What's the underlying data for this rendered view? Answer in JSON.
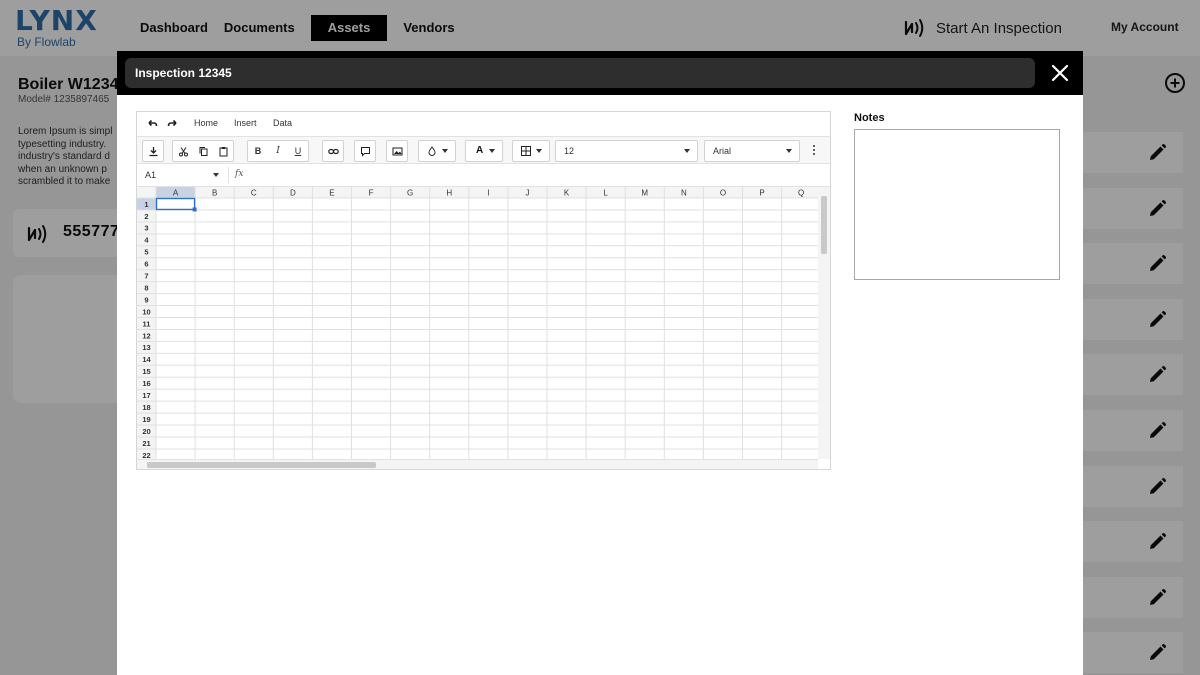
{
  "brand": {
    "name": "LYNX",
    "sub": "By Flowlab",
    "color": "#2f6fa8"
  },
  "nav": {
    "items": [
      {
        "label": "Dashboard"
      },
      {
        "label": "Documents"
      },
      {
        "label": "Assets"
      },
      {
        "label": "Vendors"
      }
    ],
    "active": "Assets",
    "start_inspection": "Start An Inspection",
    "start_inspection_icon": "nfc-icon",
    "my_account": "My Account"
  },
  "asset": {
    "title": "Boiler W1234",
    "model": "Model# 1235897465",
    "description_lines": [
      "Lorem Ipsum is simpl",
      "typesetting industry.",
      "industry's standard d",
      "when an unknown p",
      "scrambled it to make"
    ],
    "tag_icon": "nfc-icon",
    "tag_number": "555777"
  },
  "side_actions": {
    "add_icon": "plus-circle-icon",
    "row_icon": "pencil-icon",
    "row_count": 10
  },
  "modal": {
    "title": "Inspection 12345",
    "close_icon": "close-icon",
    "spreadsheet": {
      "menu": [
        "Home",
        "Insert",
        "Data"
      ],
      "toolbar": {
        "font_size": "12",
        "font_family": "Arial",
        "bold_glyph": "B",
        "italic_glyph": "I",
        "underline_glyph": "U",
        "text_color_glyph": "A"
      },
      "cell_ref": "A1",
      "fx_label": "fx",
      "formula_value": "",
      "columns": [
        "A",
        "B",
        "C",
        "D",
        "E",
        "F",
        "G",
        "H",
        "I",
        "J",
        "K",
        "L",
        "M",
        "N",
        "O",
        "P",
        "Q"
      ],
      "rows": [
        "1",
        "2",
        "3",
        "4",
        "5",
        "6",
        "7",
        "8",
        "9",
        "10",
        "11",
        "12",
        "13",
        "14",
        "15",
        "16",
        "17",
        "18",
        "19",
        "20",
        "21",
        "22"
      ],
      "selected_cell": "A1"
    },
    "notes": {
      "label": "Notes",
      "value": ""
    }
  }
}
